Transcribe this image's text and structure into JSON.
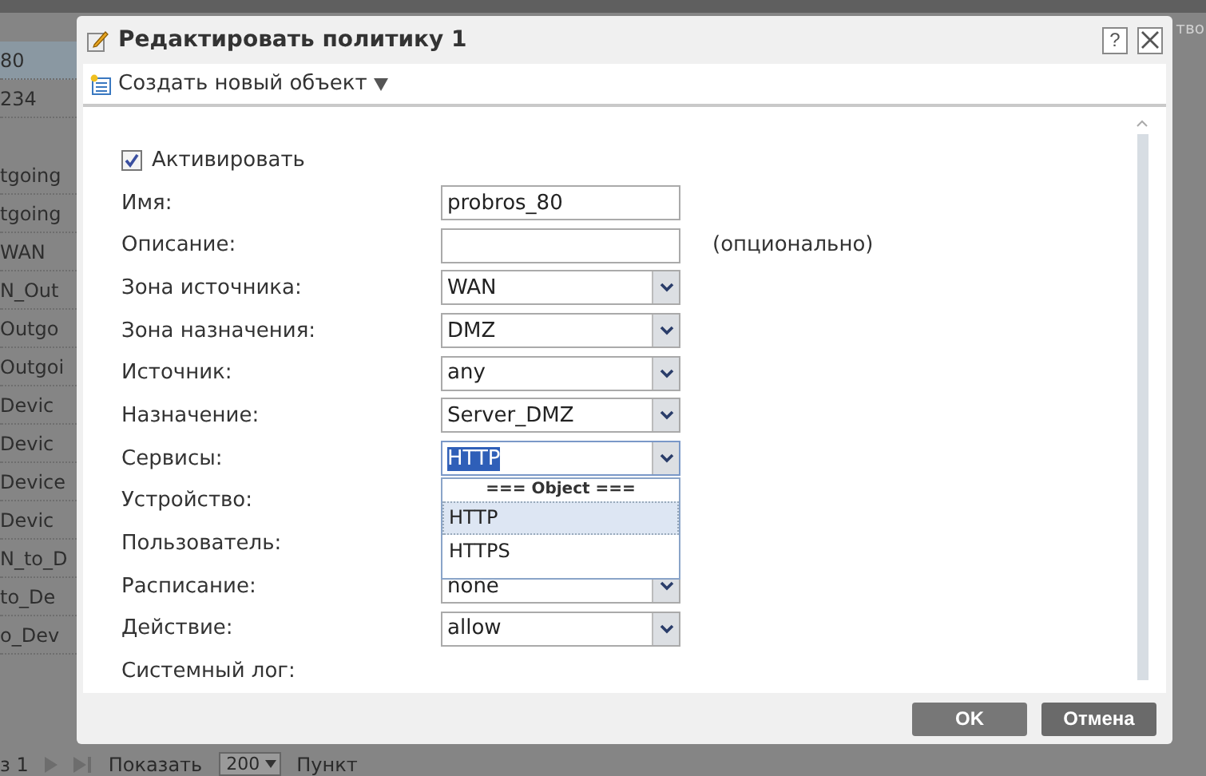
{
  "background_header": {
    "text": "тво"
  },
  "background_table": {
    "rows": [
      {
        "cell": "80",
        "selected": true
      },
      {
        "cell": "234",
        "selected": false
      },
      {
        "cell": "tgoing",
        "selected": false
      },
      {
        "cell": "tgoing",
        "selected": false
      },
      {
        "cell": "WAN",
        "selected": false
      },
      {
        "cell": "N_Out",
        "selected": false
      },
      {
        "cell": "Outgo",
        "selected": false
      },
      {
        "cell": "Outgoi",
        "selected": false
      },
      {
        "cell": "Devic",
        "selected": false
      },
      {
        "cell": "Devic",
        "selected": false
      },
      {
        "cell": "Device",
        "selected": false
      },
      {
        "cell": "Devic",
        "selected": false
      },
      {
        "cell": "N_to_D",
        "selected": false
      },
      {
        "cell": "to_De",
        "selected": false
      },
      {
        "cell": "o_Dev",
        "selected": false
      }
    ]
  },
  "background_footer": {
    "page": "з 1",
    "show_label": "Показать",
    "per_page": "200",
    "unit": "Пункт"
  },
  "dialog": {
    "title": "Редактировать политику 1",
    "help": "?",
    "toolbar": {
      "create_button": "Создать новый объект"
    },
    "enable": {
      "label": "Активировать",
      "checked": true
    },
    "fields": [
      {
        "label": "Имя:",
        "kind": "text",
        "value": "probros_80"
      },
      {
        "label": "Описание:",
        "kind": "text",
        "hint": "(опционально)"
      },
      {
        "label": "Зона источника:",
        "kind": "select",
        "value": "WAN"
      },
      {
        "label": "Зона назначения:",
        "kind": "select",
        "value": "DMZ"
      },
      {
        "label": "Источник:",
        "kind": "select",
        "value": "any"
      },
      {
        "label": "Назначение:",
        "kind": "select",
        "value": "Server_DMZ"
      },
      {
        "label": "Сервисы:",
        "kind": "select",
        "value": "HTTP",
        "open": true
      },
      {
        "label": "Устройство:",
        "kind": "label"
      },
      {
        "label": "Пользователь:",
        "kind": "label"
      },
      {
        "label": "Расписание:",
        "kind": "select",
        "value": "none"
      },
      {
        "label": "Действие:",
        "kind": "select",
        "value": "allow"
      },
      {
        "label": "Системный лог:",
        "kind": "label"
      }
    ],
    "services_dropdown": {
      "header": "=== Object ===",
      "options": [
        {
          "label": "HTTP",
          "selected": true
        },
        {
          "label": "HTTPS",
          "selected": false
        }
      ]
    },
    "buttons": [
      {
        "label": "OK",
        "kind": "primary"
      },
      {
        "label": "Отмена",
        "kind": "secondary"
      }
    ]
  }
}
